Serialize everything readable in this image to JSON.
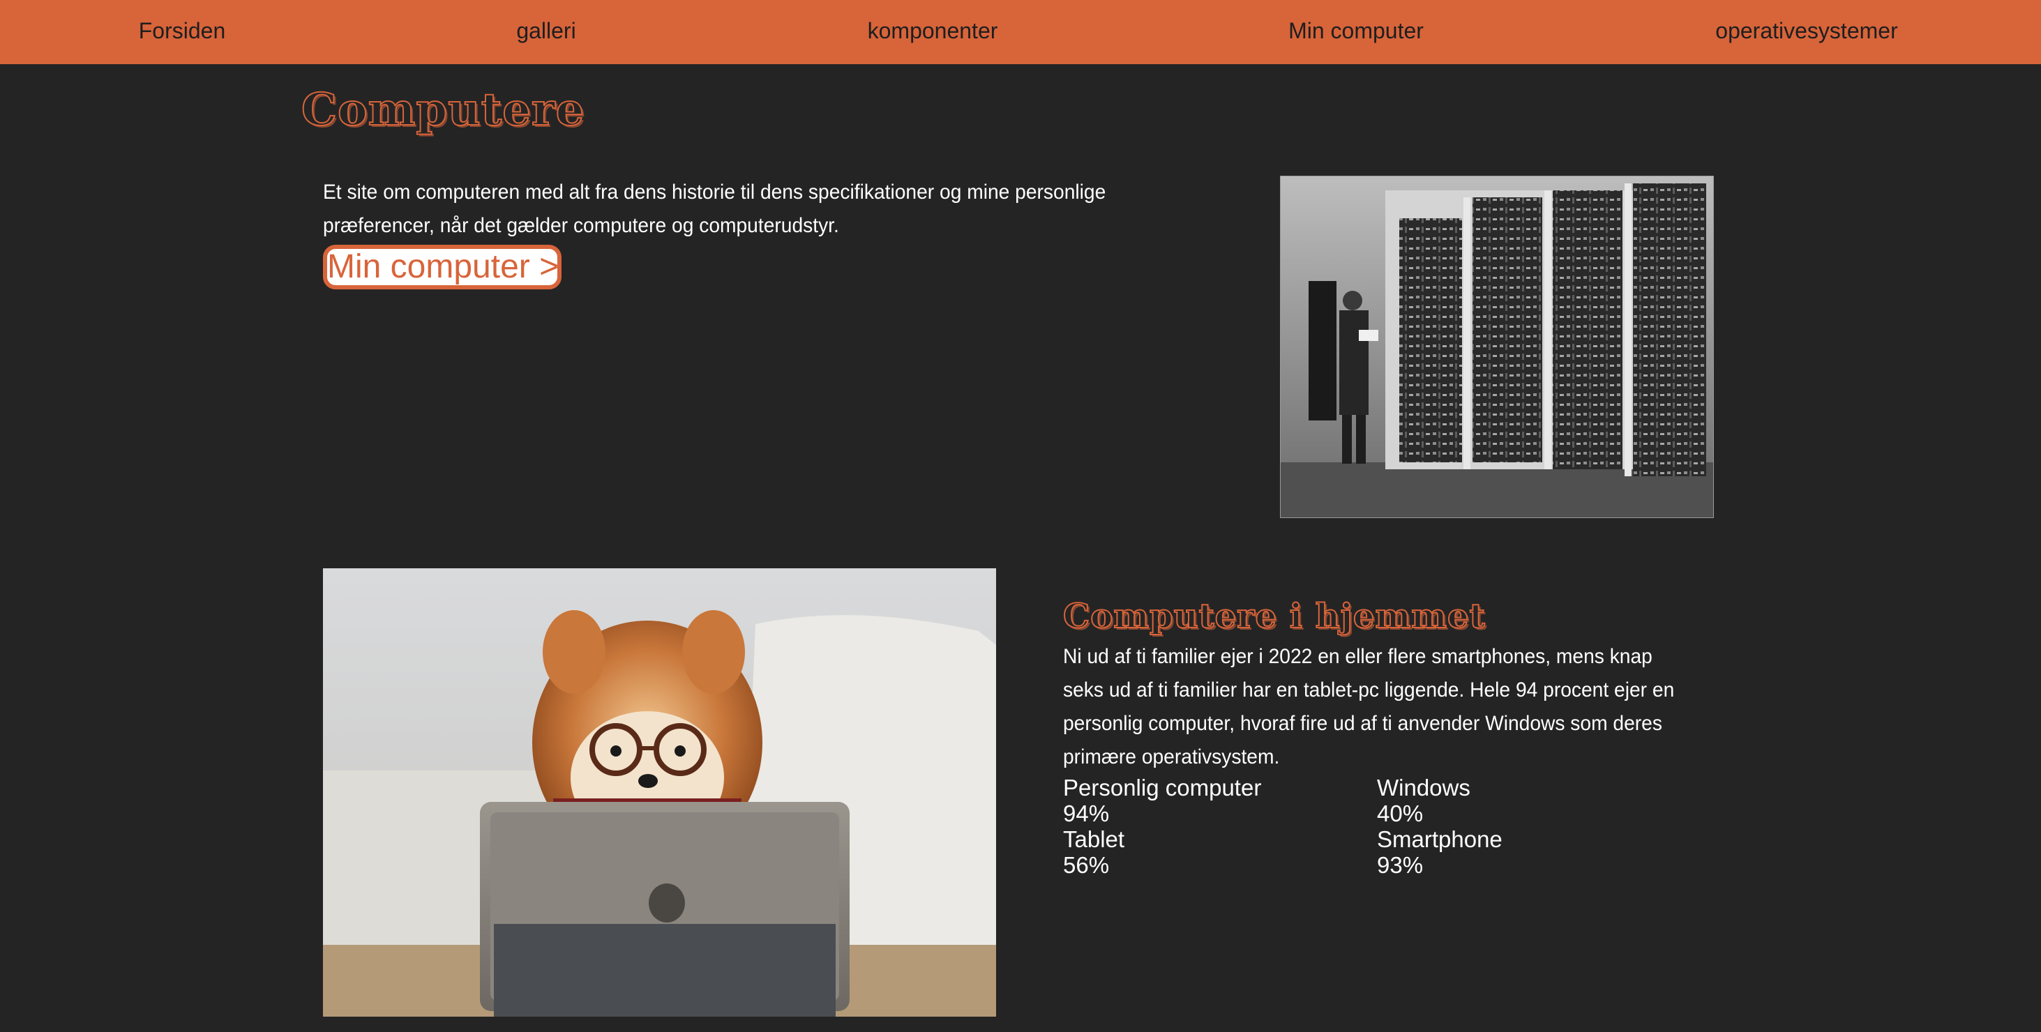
{
  "nav": {
    "items": [
      {
        "label": "Forsiden"
      },
      {
        "label": "galleri"
      },
      {
        "label": "komponenter"
      },
      {
        "label": "Min computer"
      },
      {
        "label": "operativesystemer"
      }
    ]
  },
  "hero": {
    "title": "Computere",
    "intro": "Et site om computeren med alt fra dens historie til dens specifikationer og mine personlige præferencer, når det gælder computere og computerudstyr.",
    "button_label": "Min computer >"
  },
  "home": {
    "title": "Computere i hjemmet",
    "text": "Ni ud af ti familier ejer i 2022 en eller flere smartphones, mens knap seks ud af ti familier har en tablet-pc liggende. Hele 94 procent ejer en personlig computer, hvoraf fire ud af ti anvender Windows som deres primære operativsystem.",
    "stats": [
      {
        "label": "Personlig computer",
        "value": "94%"
      },
      {
        "label": "Windows",
        "value": "40%"
      },
      {
        "label": "Tablet",
        "value": "56%"
      },
      {
        "label": "Smartphone",
        "value": "93%"
      }
    ]
  },
  "colors": {
    "accent": "#d8643a",
    "background": "#242424",
    "text": "#ffffff"
  }
}
